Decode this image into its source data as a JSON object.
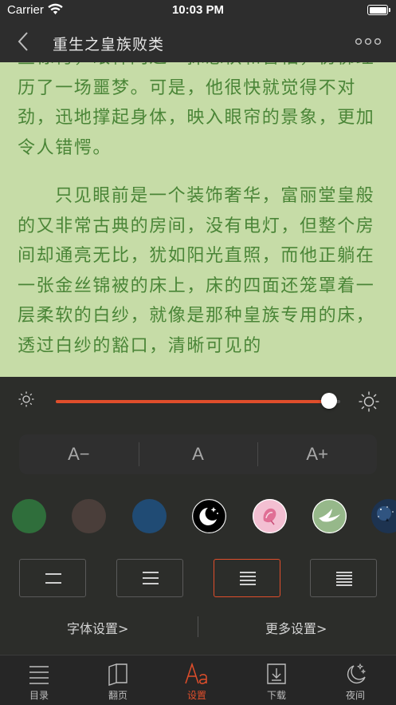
{
  "status_bar": {
    "carrier": "Carrier",
    "time": "10:03 PM"
  },
  "nav": {
    "title": "重生之皇族败类"
  },
  "reader": {
    "paragraphs": [
      {
        "indent": false,
        "text": "些惊愕，眼神闪过一抹恐惧和害怕，仿佛经历了一场噩梦。可是，他很快就觉得不对劲，迅地撑起身体，映入眼帘的景象，更加令人错愕。"
      },
      {
        "indent": true,
        "text": "只见眼前是一个装饰奢华，富丽堂皇般的又非常古典的房间，没有电灯，但整个房间却通亮无比，犹如阳光直照，而他正躺在一张金丝锦被的床上，床的四面还笼罩着一层柔软的白纱，就像是那种皇族专用的床，透过白纱的豁口，清晰可见的"
      }
    ]
  },
  "settings": {
    "brightness": {
      "value": 0.96,
      "min_icon": "sun-small-icon",
      "max_icon": "sun-large-icon",
      "accent": "#e04e2b"
    },
    "font_size": {
      "decrease": "A−",
      "default": "A",
      "increase": "A+"
    },
    "themes": [
      {
        "name": "green-theme",
        "color": "#2f6e3b"
      },
      {
        "name": "brown-theme",
        "color": "#4a3e3a"
      },
      {
        "name": "blue-theme",
        "color": "#204b74"
      },
      {
        "name": "night-theme",
        "color": "#000000"
      },
      {
        "name": "pink-theme",
        "color": "#f3bfd2"
      },
      {
        "name": "bird-theme",
        "color": "#96b88a"
      },
      {
        "name": "starry-theme",
        "color": "#1d3350"
      }
    ],
    "line_spacing": {
      "selected": 2
    },
    "links": {
      "font_settings": "字体设置>",
      "more_settings": "更多设置>"
    }
  },
  "tabs": [
    {
      "id": "catalog",
      "label": "目录",
      "icon": "list-icon"
    },
    {
      "id": "page-turn",
      "label": "翻页",
      "icon": "book-icon"
    },
    {
      "id": "settings",
      "label": "设置",
      "icon": "font-settings-icon",
      "active": true
    },
    {
      "id": "download",
      "label": "下载",
      "icon": "download-icon"
    },
    {
      "id": "night",
      "label": "夜间",
      "icon": "night-mode-icon"
    }
  ]
}
